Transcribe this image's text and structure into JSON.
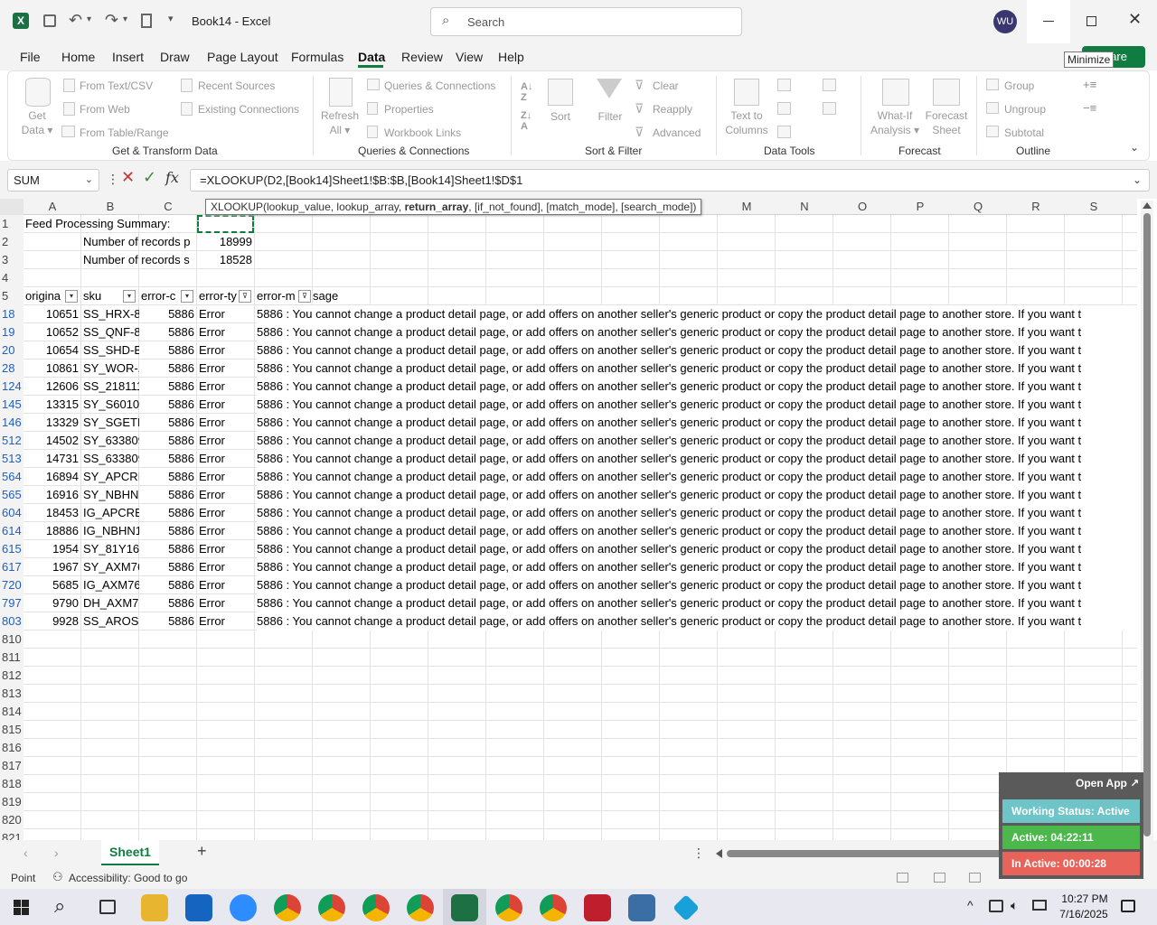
{
  "titlebar": {
    "app_icon": "excel-icon",
    "title": "Book14 - Excel",
    "search_placeholder": "Search",
    "avatar": "WU",
    "minimize_tooltip": "Minimize",
    "share_label": "are"
  },
  "tabs": [
    "File",
    "Home",
    "Insert",
    "Draw",
    "Page Layout",
    "Formulas",
    "Data",
    "Review",
    "View",
    "Help"
  ],
  "active_tab": "Data",
  "ribbon": {
    "get_data": "Get\nData",
    "from_text": "From Text/CSV",
    "from_web": "From Web",
    "from_table": "From Table/Range",
    "recent_sources": "Recent Sources",
    "existing_connections": "Existing Connections",
    "group_get": "Get & Transform Data",
    "refresh_all": "Refresh\nAll",
    "queries_connections": "Queries & Connections",
    "properties": "Properties",
    "workbook_links": "Workbook Links",
    "group_queries": "Queries & Connections",
    "sort": "Sort",
    "filter": "Filter",
    "clear": "Clear",
    "reapply": "Reapply",
    "advanced": "Advanced",
    "group_sort": "Sort & Filter",
    "text_to_columns": "Text to\nColumns",
    "group_tools": "Data Tools",
    "what_if": "What-If\nAnalysis",
    "forecast_sheet": "Forecast\nSheet",
    "group_forecast": "Forecast",
    "group": "Group",
    "ungroup": "Ungroup",
    "subtotal": "Subtotal",
    "group_outline": "Outline"
  },
  "formula_bar": {
    "name_box": "SUM",
    "formula": "=XLOOKUP(D2,[Book14]Sheet1!$B:$B,[Book14]Sheet1!$D$1",
    "tooltip_pre": "XLOOKUP(lookup_value, lookup_array, ",
    "tooltip_bold": "return_array",
    "tooltip_post": ", [if_not_found], [match_mode], [search_mode])"
  },
  "columns": [
    "A",
    "B",
    "C",
    "",
    "",
    "",
    "",
    "",
    "",
    "",
    "",
    "",
    "M",
    "N",
    "O",
    "P",
    "Q",
    "R",
    "S"
  ],
  "summary": {
    "title": "Feed Processing Summary:",
    "label1": "Number of records p",
    "value1": "18999",
    "label2": "Number of records s",
    "value2": "18528"
  },
  "headers": {
    "a": "origina",
    "b": "sku",
    "c": "error-c",
    "d": "error-ty",
    "e": "error-m",
    "f": "sage"
  },
  "message": "5886 : You cannot change a product detail page, or add offers on another seller's generic product or copy the product detail page to another store. If you want t",
  "rows": [
    {
      "rn": "18",
      "a": "10651",
      "b": "SS_HRX-83",
      "c": "5886",
      "d": "Error"
    },
    {
      "rn": "19",
      "a": "10652",
      "b": "SS_QNF-8",
      "c": "5886",
      "d": "Error"
    },
    {
      "rn": "20",
      "a": "10654",
      "b": "SS_SHD-B-",
      "c": "5886",
      "d": "Error"
    },
    {
      "rn": "28",
      "a": "10861",
      "b": "SY_WOR-1",
      "c": "5886",
      "d": "Error"
    },
    {
      "rn": "124",
      "a": "12606",
      "b": "SS_218111",
      "c": "5886",
      "d": "Error"
    },
    {
      "rn": "145",
      "a": "13315",
      "b": "SY_S6010-",
      "c": "5886",
      "d": "Error"
    },
    {
      "rn": "146",
      "a": "13329",
      "b": "SY_SGETF",
      "c": "5886",
      "d": "Error"
    },
    {
      "rn": "512",
      "a": "14502",
      "b": "SY_633809",
      "c": "5886",
      "d": "Error"
    },
    {
      "rn": "513",
      "a": "14731",
      "b": "SS_633809",
      "c": "5886",
      "d": "Error"
    },
    {
      "rn": "564",
      "a": "16894",
      "b": "SY_APCRB",
      "c": "5886",
      "d": "Error"
    },
    {
      "rn": "565",
      "a": "16916",
      "b": "SY_NBHN",
      "c": "5886",
      "d": "Error"
    },
    {
      "rn": "604",
      "a": "18453",
      "b": "IG_APCRB",
      "c": "5886",
      "d": "Error"
    },
    {
      "rn": "614",
      "a": "18886",
      "b": "IG_NBHN1",
      "c": "5886",
      "d": "Error"
    },
    {
      "rn": "615",
      "a": "1954",
      "b": "SY_81Y162",
      "c": "5886",
      "d": "Error"
    },
    {
      "rn": "617",
      "a": "1967",
      "b": "SY_AXM76",
      "c": "5886",
      "d": "Error"
    },
    {
      "rn": "720",
      "a": "5685",
      "b": "IG_AXM76",
      "c": "5886",
      "d": "Error"
    },
    {
      "rn": "797",
      "a": "9790",
      "b": "DH_AXM7",
      "c": "5886",
      "d": "Error"
    },
    {
      "rn": "803",
      "a": "9928",
      "b": "SS_AROS I",
      "c": "5886",
      "d": "Error"
    }
  ],
  "empty_rows": [
    "810",
    "811",
    "812",
    "813",
    "814",
    "815",
    "816",
    "817",
    "818",
    "819",
    "820",
    "821"
  ],
  "sheet_tab": "Sheet1",
  "status": {
    "point": "Point",
    "accessibility": "Accessibility: Good to go"
  },
  "widget": {
    "open_app": "Open App ↗",
    "working": "Working Status: Active",
    "active": "Active: 04:22:11",
    "inactive": "In Active: 00:00:28",
    "active_color": "#4cb84c",
    "working_color": "#6fc4c8",
    "inactive_color": "#e8645a"
  },
  "taskbar": {
    "time": "10:27 PM",
    "date": "7/16/2025"
  }
}
